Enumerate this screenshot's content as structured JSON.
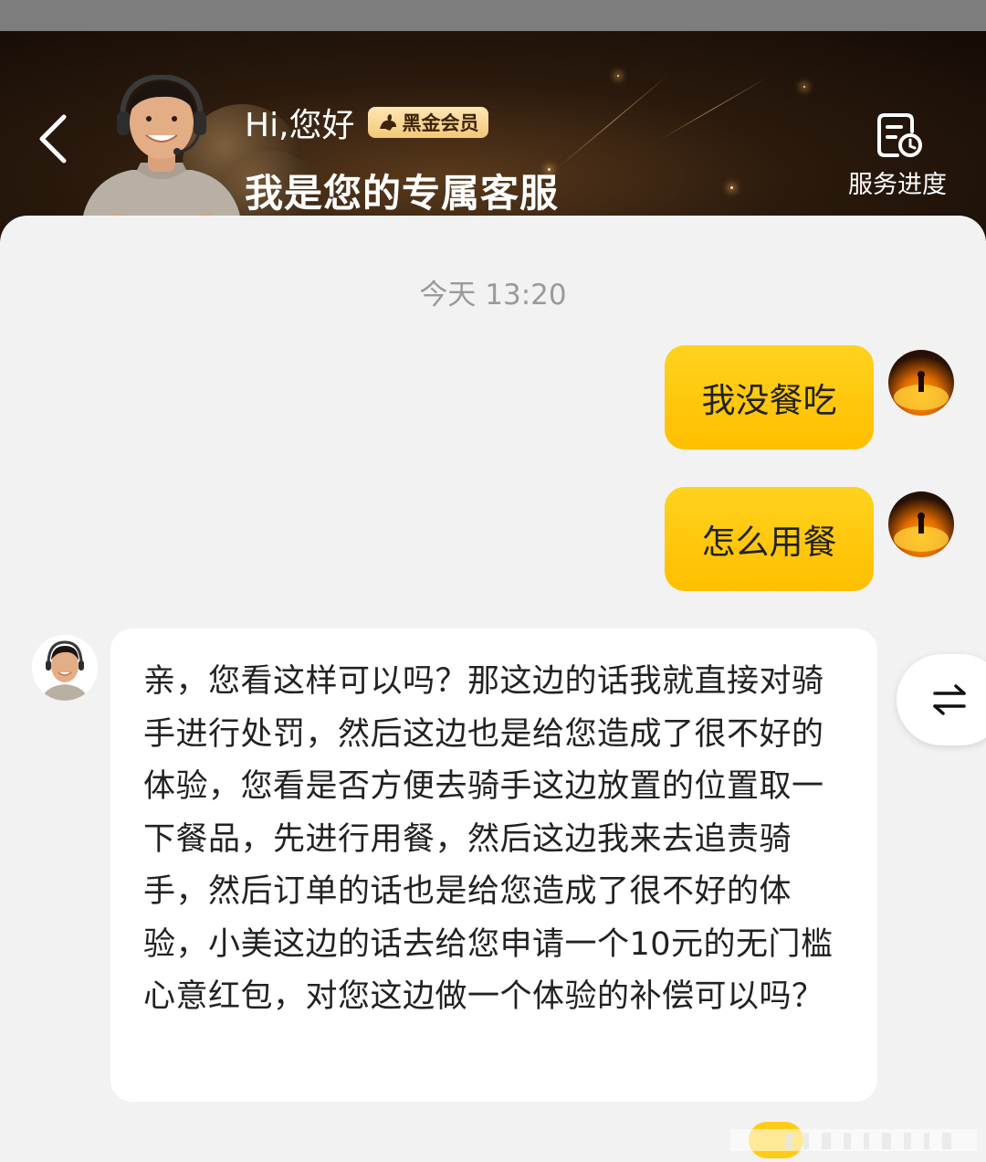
{
  "header": {
    "greeting": "Hi,您好",
    "badge_label": "黑金会员",
    "subtitle": "我是您的专属客服",
    "service_progress_label": "服务进度",
    "back_icon": "chevron-left-icon",
    "service_icon": "document-clock-icon"
  },
  "chat": {
    "timestamp": "今天 13:20",
    "messages": [
      {
        "sender": "user",
        "text": "我没餐吃"
      },
      {
        "sender": "user",
        "text": "怎么用餐"
      },
      {
        "sender": "agent",
        "text": "亲，您看这样可以吗？那这边的话我就直接对骑手进行处罚，然后这边也是给您造成了很不好的体验，您看是否方便去骑手这边放置的位置取一下餐品，先进行用餐，然后这边我来去追责骑手，然后订单的话也是给您造成了很不好的体验，小美这边的话去给您申请一个10元的无门槛心意红包，对您这边做一个体验的补偿可以吗？"
      }
    ]
  },
  "colors": {
    "user_bubble": "#ffc800",
    "header_bg": "#2b1a0d",
    "badge_bg": "#f3c877",
    "chat_bg": "#f2f2f2"
  },
  "switch_icon": "swap-arrows-icon"
}
